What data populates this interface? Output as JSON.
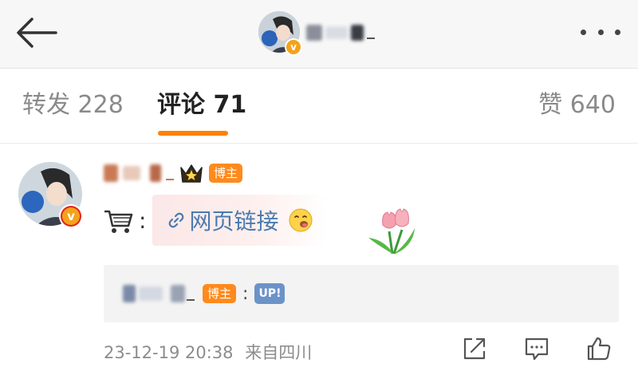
{
  "header": {
    "back_icon": "arrow-left-icon",
    "more_icon": "more-dots-icon",
    "verified_mark": "v"
  },
  "tabs": [
    {
      "label": "转发 228",
      "active": false
    },
    {
      "label": "评论 71",
      "active": true
    },
    {
      "label": "赞 640",
      "active": false
    }
  ],
  "comment": {
    "author_tag": "博主",
    "verified_mark": "v",
    "cart_icon": "cart-icon",
    "link_text": "网页链接",
    "emoji": "smirk-emoji-icon",
    "sticker": "tulip-sticker",
    "reply": {
      "tag": "博主",
      "separator": ":",
      "content": "UP!"
    },
    "timestamp": "23-12-19 20:38",
    "location": "来自四川",
    "actions": [
      "share-icon",
      "comment-icon",
      "like-icon"
    ]
  },
  "colors": {
    "accent": "#ff8200",
    "link": "#4a7ab0",
    "tag": "#ff8a1c",
    "up_tag": "#6b93c8",
    "verified": "#f4a21c"
  }
}
